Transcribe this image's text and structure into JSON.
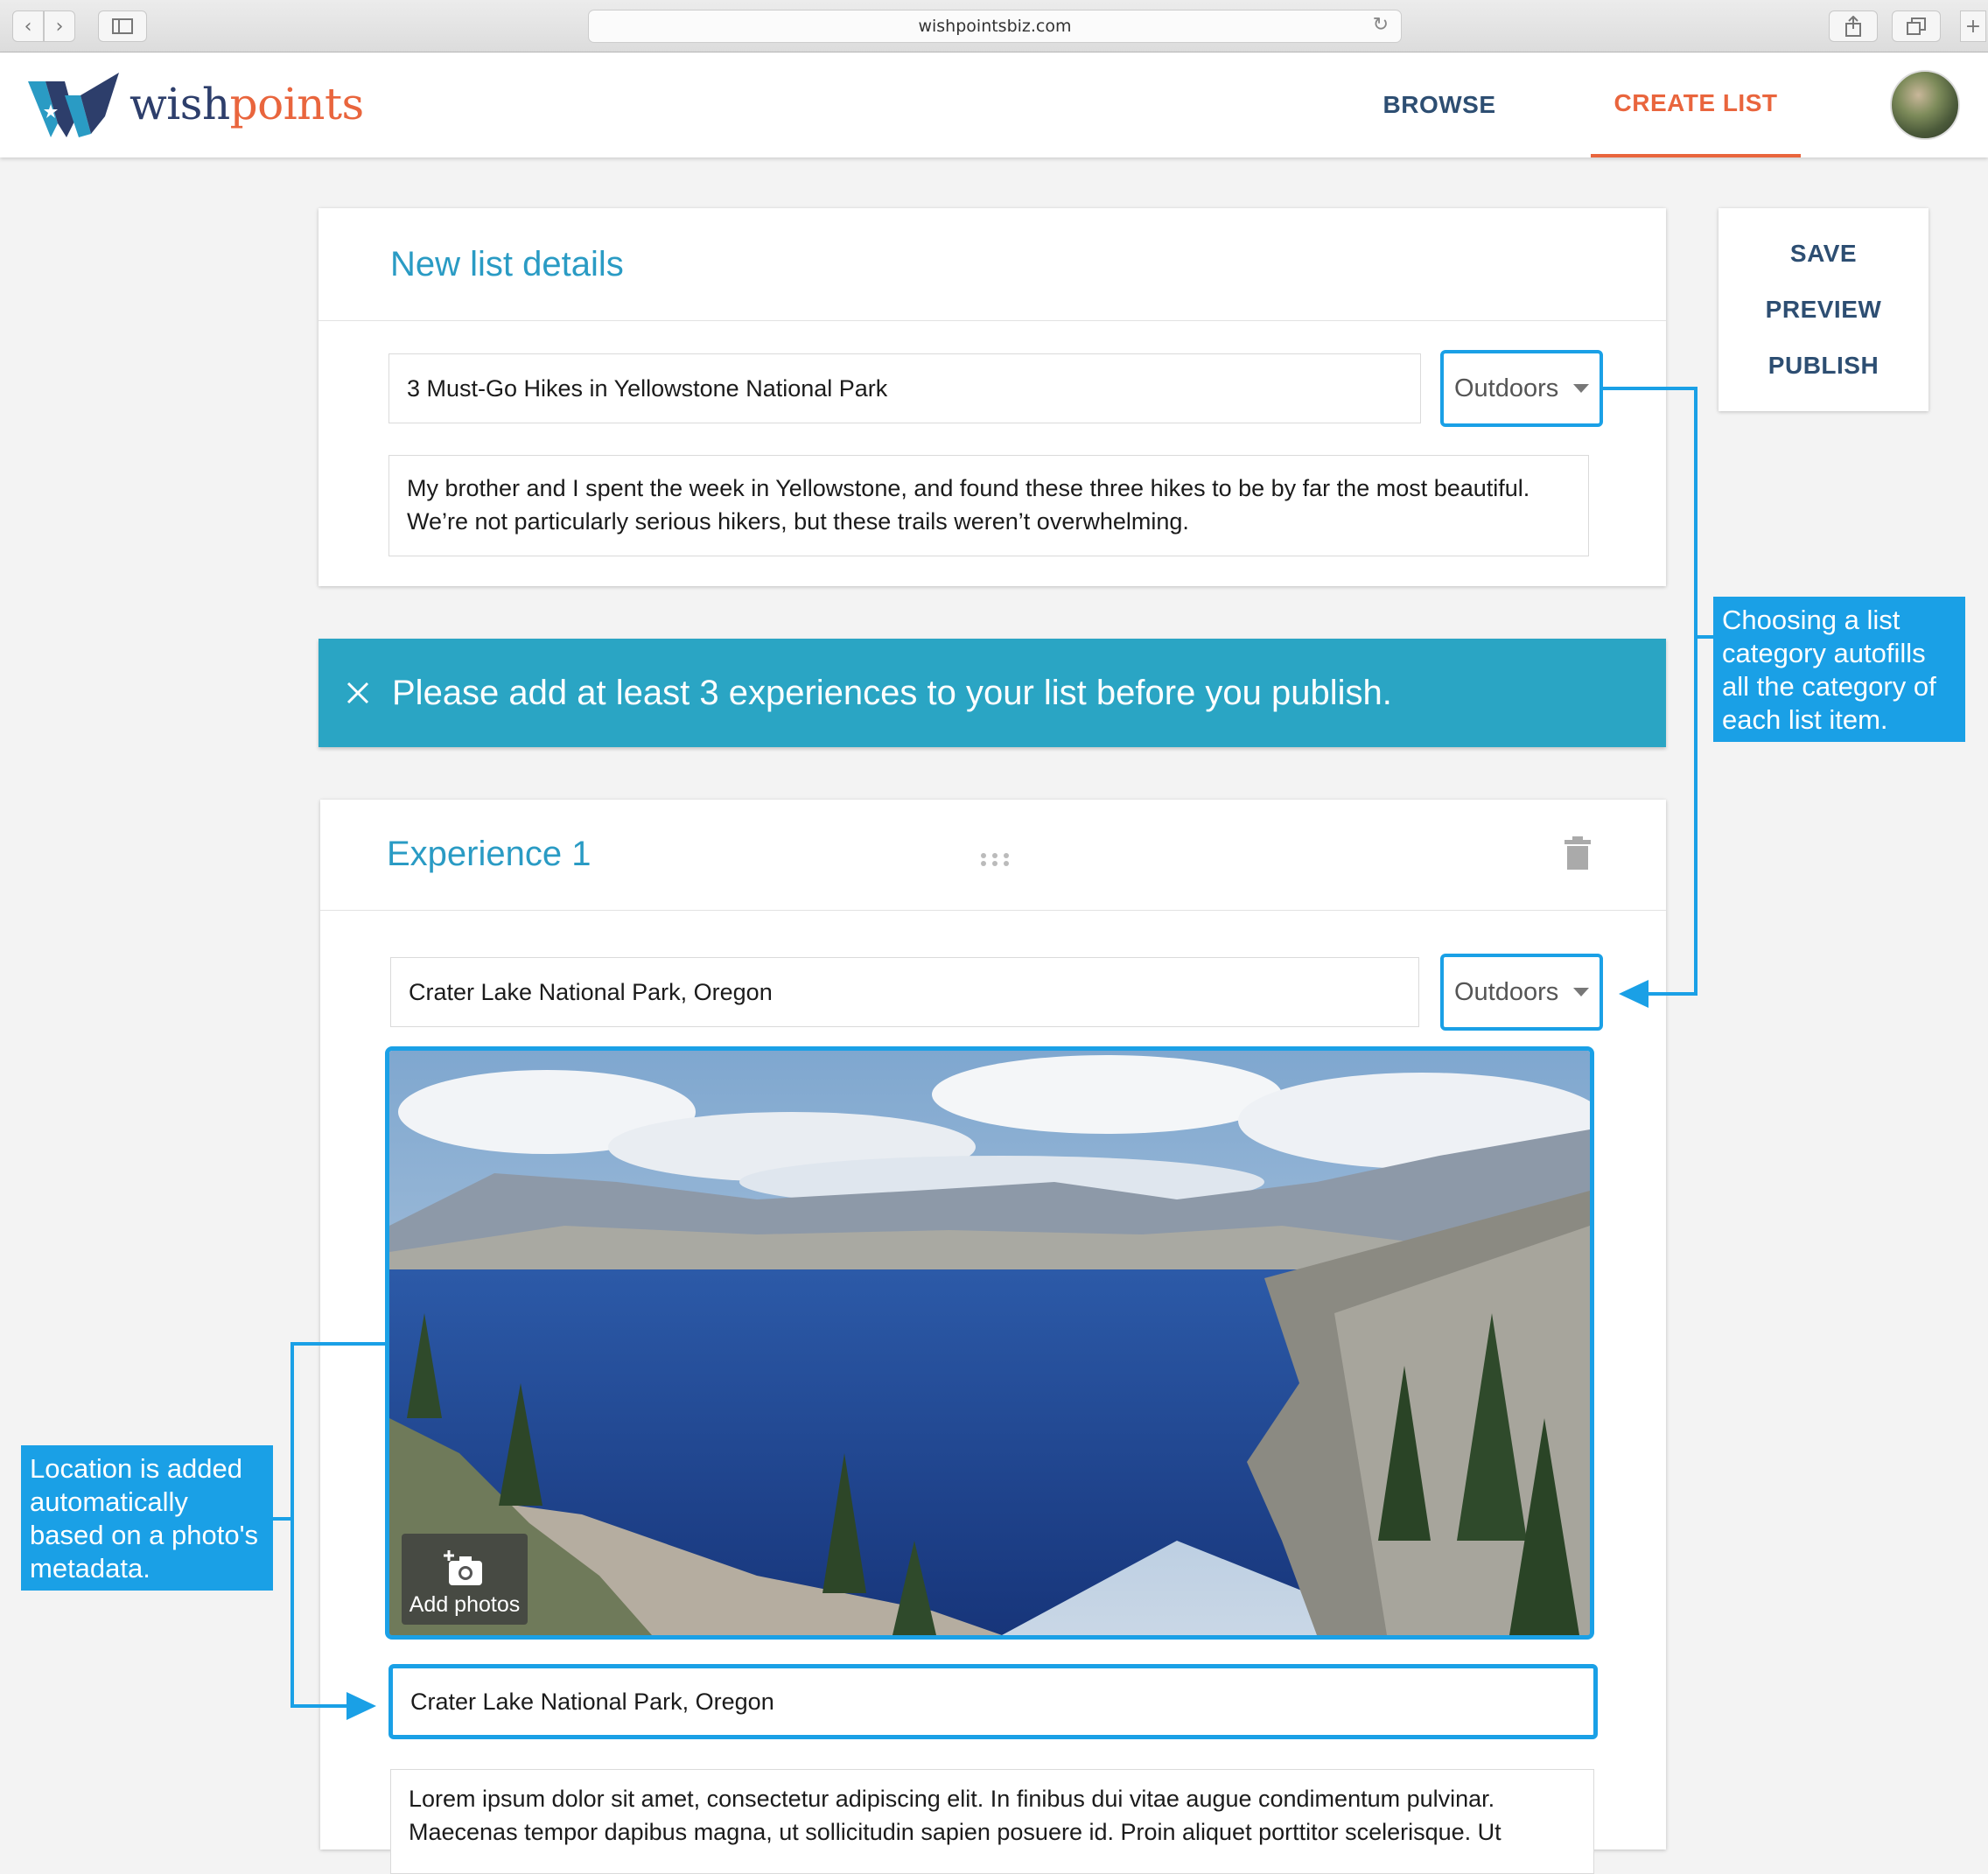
{
  "browser": {
    "url": "wishpointsbiz.com"
  },
  "brand": {
    "name_part1": "wish",
    "name_part2": "points",
    "colors": {
      "primary_blue": "#2a9bc4",
      "accent_orange": "#e9653d",
      "navy": "#2d4e72",
      "annotation_blue": "#1aa0e6"
    }
  },
  "nav": {
    "browse": "BROWSE",
    "create_list": "CREATE LIST",
    "active": "create_list"
  },
  "actions": {
    "save": "SAVE",
    "preview": "PREVIEW",
    "publish": "PUBLISH"
  },
  "list_details": {
    "heading": "New list details",
    "title_value": "3 Must-Go Hikes in Yellowstone National Park",
    "category": "Outdoors",
    "description": "My brother and I spent the week in Yellowstone, and found these three hikes to be by far the most beautiful. We’re not particularly serious hikers, but these trails weren’t overwhelming."
  },
  "alert": {
    "message": "Please add at least 3 experiences to your list before you publish."
  },
  "experience": {
    "heading": "Experience 1",
    "name_value": "Crater Lake National Park, Oregon",
    "category": "Outdoors",
    "add_photos_label": "Add photos",
    "location_value": "Crater Lake National Park, Oregon",
    "description": "Lorem ipsum dolor sit amet, consectetur adipiscing elit. In finibus dui vitae augue condimentum pulvinar. Maecenas tempor dapibus magna, ut sollicitudin sapien posuere id. Proin aliquet porttitor scelerisque. Ut"
  },
  "annotations": {
    "category_note": "Choosing a list category autofills all the category of each list item.",
    "location_note": "Location is added automatically based on a photo's metadata."
  },
  "icons": {
    "back": "chevron-left-icon",
    "forward": "chevron-right-icon",
    "sidebar": "sidebar-icon",
    "reload": "reload-icon",
    "share": "share-icon",
    "tabs": "tabs-icon",
    "new_tab": "plus-icon",
    "close": "close-icon",
    "drag": "drag-handle-icon",
    "delete": "trash-icon",
    "camera": "camera-add-icon"
  }
}
